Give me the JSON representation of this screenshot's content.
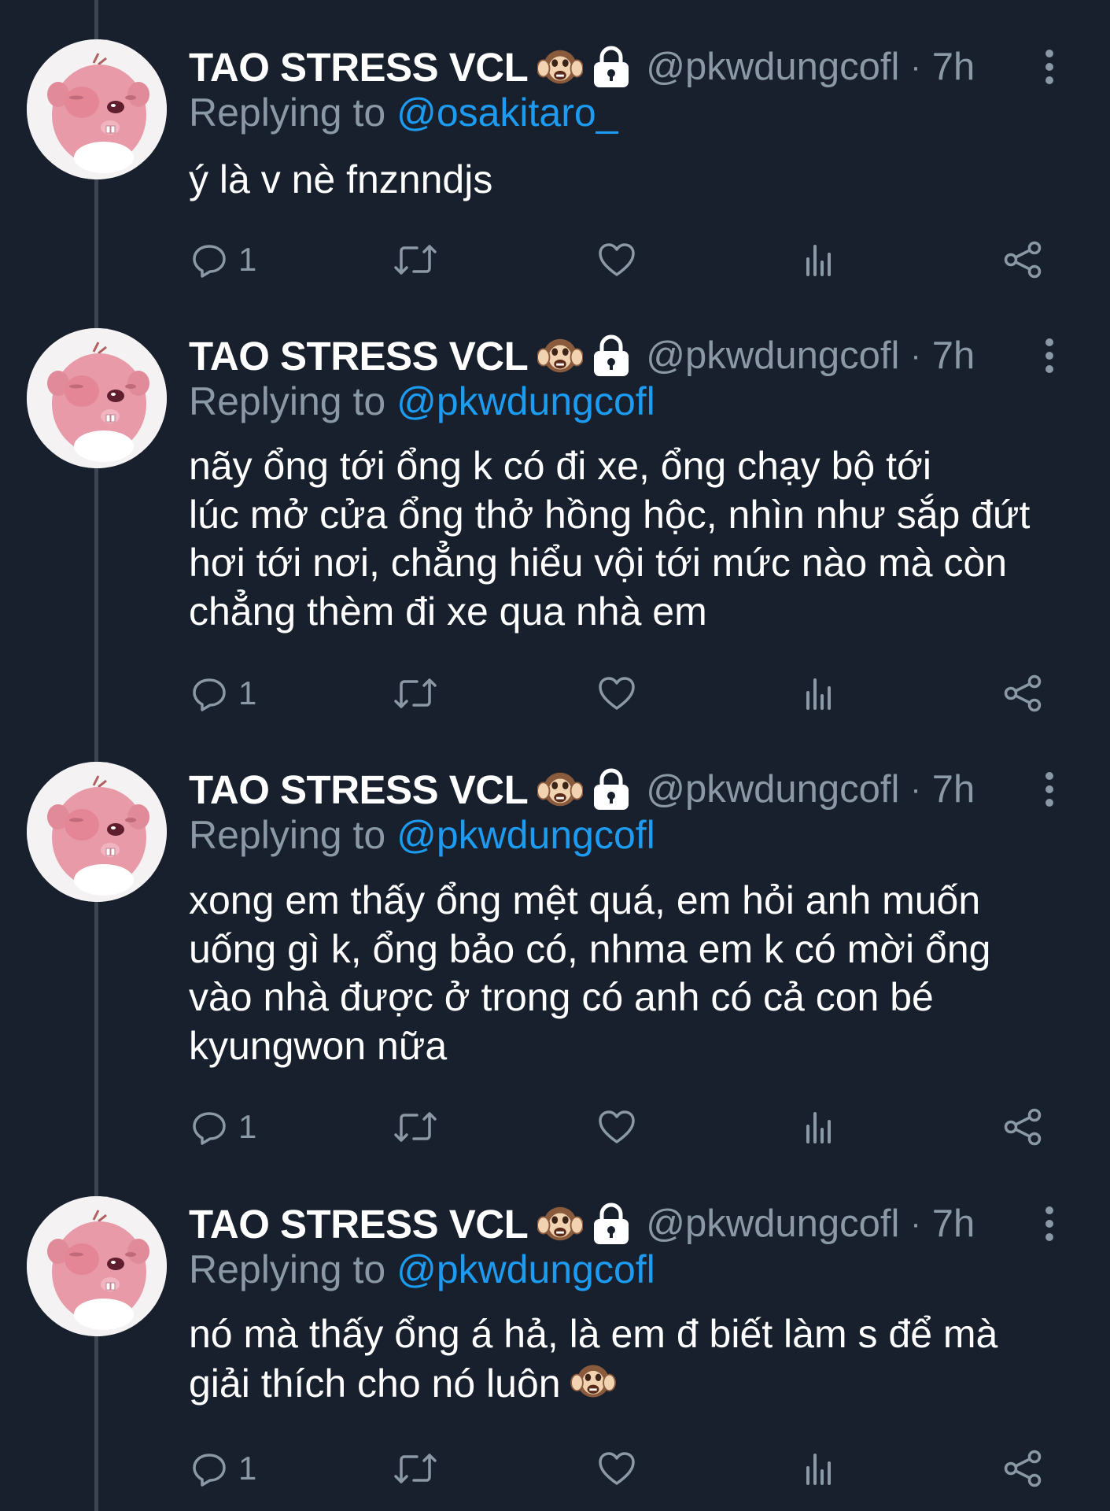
{
  "tweets": [
    {
      "display_name": "TAO STRESS VCL",
      "handle": "@pkwdungcofl",
      "separator": "·",
      "time": "7h",
      "replying_prefix": "Replying to",
      "replying_to": "@osakitaro_",
      "text": "ý là v nè fnznndjs",
      "reply_count": "1"
    },
    {
      "display_name": "TAO STRESS VCL",
      "handle": "@pkwdungcofl",
      "separator": "·",
      "time": "7h",
      "replying_prefix": "Replying to",
      "replying_to": "@pkwdungcofl",
      "text": "nãy ổng tới ổng k có đi xe, ổng chạy bộ tới\nlúc mở cửa ổng thở hồng hộc, nhìn như sắp đứt\nhơi tới nơi, chẳng hiểu vội tới mức nào mà còn\nchẳng thèm đi xe qua nhà em",
      "reply_count": "1"
    },
    {
      "display_name": "TAO STRESS VCL",
      "handle": "@pkwdungcofl",
      "separator": "·",
      "time": "7h",
      "replying_prefix": "Replying to",
      "replying_to": "@pkwdungcofl",
      "text": "xong em thấy ổng mệt quá, em hỏi anh muốn\nuống gì k, ổng bảo có, nhma em k có mời ổng\nvào nhà được ở trong có anh có cả con bé\nkyungwon nữa",
      "reply_count": "1"
    },
    {
      "display_name": "TAO STRESS VCL",
      "handle": "@pkwdungcofl",
      "separator": "·",
      "time": "7h",
      "replying_prefix": "Replying to",
      "replying_to": "@pkwdungcofl",
      "text": "nó mà thấy ổng á hả, là em đ biết làm s để mà\ngiải thích cho nó luôn",
      "reply_count": "1"
    }
  ],
  "icons": {
    "name_emoji": "hear-no-evil-monkey-icon",
    "protected": "lock-icon",
    "more": "more-vertical-icon",
    "reply": "reply-icon",
    "retweet": "retweet-icon",
    "like": "heart-icon",
    "analytics": "analytics-icon",
    "share": "share-icon",
    "text_emoji": "hear-no-evil-monkey-icon"
  },
  "colors": {
    "background": "#17202c",
    "primary_text": "#ffffff",
    "secondary_text": "#8b98a5",
    "mention": "#1d9bf0",
    "thread_line": "#3d4650"
  }
}
